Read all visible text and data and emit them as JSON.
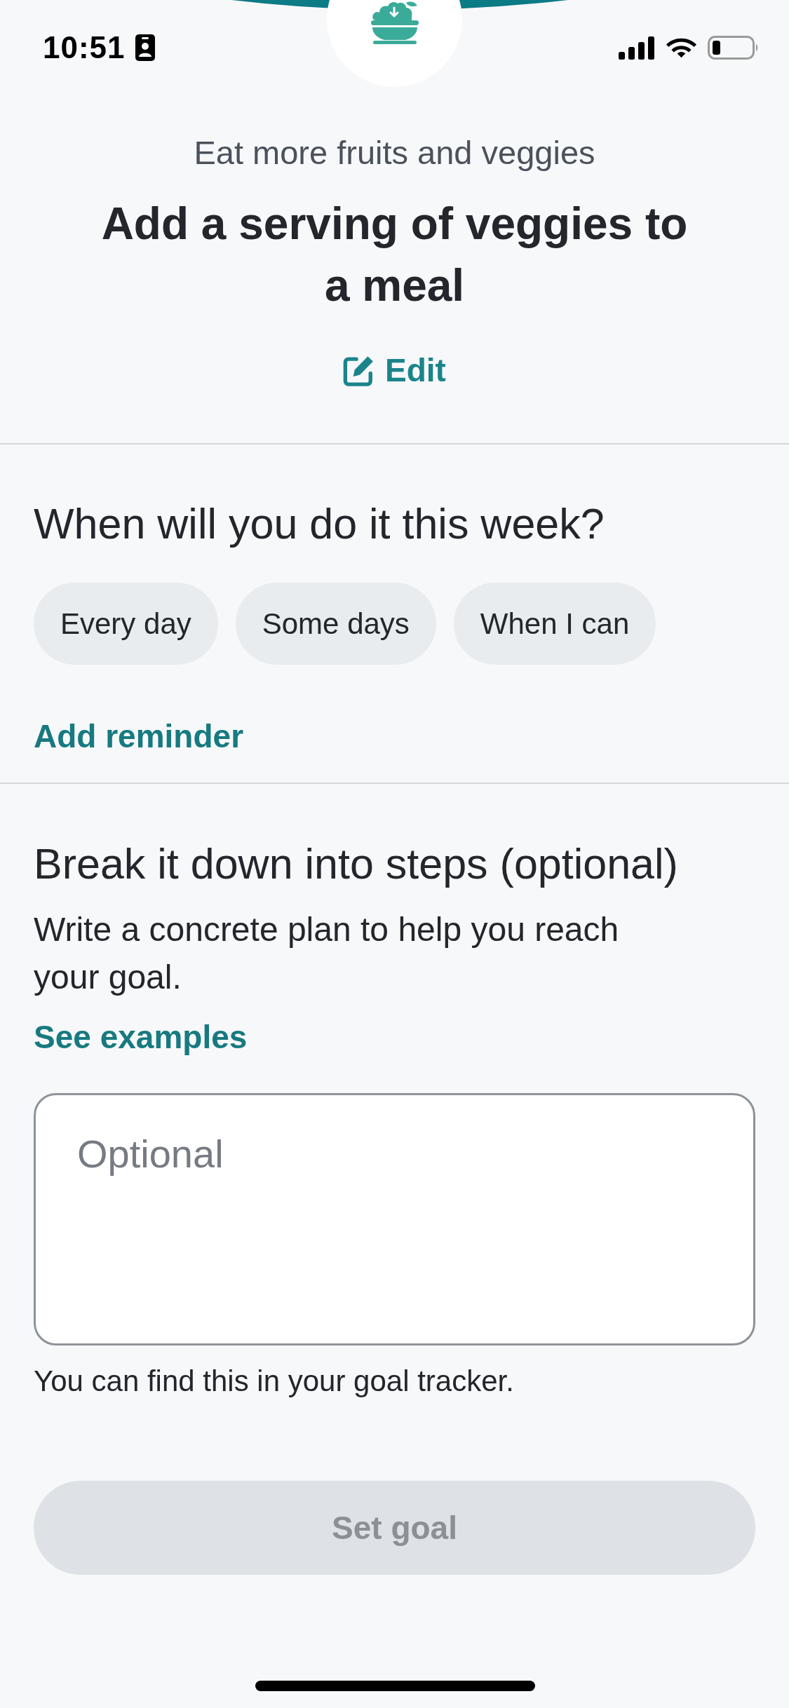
{
  "status_bar": {
    "time": "10:51"
  },
  "header": {
    "category": "Eat more fruits and veggies",
    "title": "Add a serving of veggies to a meal",
    "edit_link": "Edit"
  },
  "schedule": {
    "question": "When will you do it this week?",
    "options": [
      {
        "label": "Every day",
        "selected": false
      },
      {
        "label": "Some days",
        "selected": false
      },
      {
        "label": "When I can",
        "selected": false
      }
    ],
    "reminder_link": "Add reminder"
  },
  "steps": {
    "heading": "Break it down into steps (optional)",
    "description": "Write a concrete plan to help you reach your goal.",
    "examples_link": "See examples",
    "plan_field": {
      "placeholder": "Optional"
    },
    "hint": "You can find this in your goal tracker."
  },
  "primary_button": {
    "label": "Set goal",
    "disabled": true
  }
}
